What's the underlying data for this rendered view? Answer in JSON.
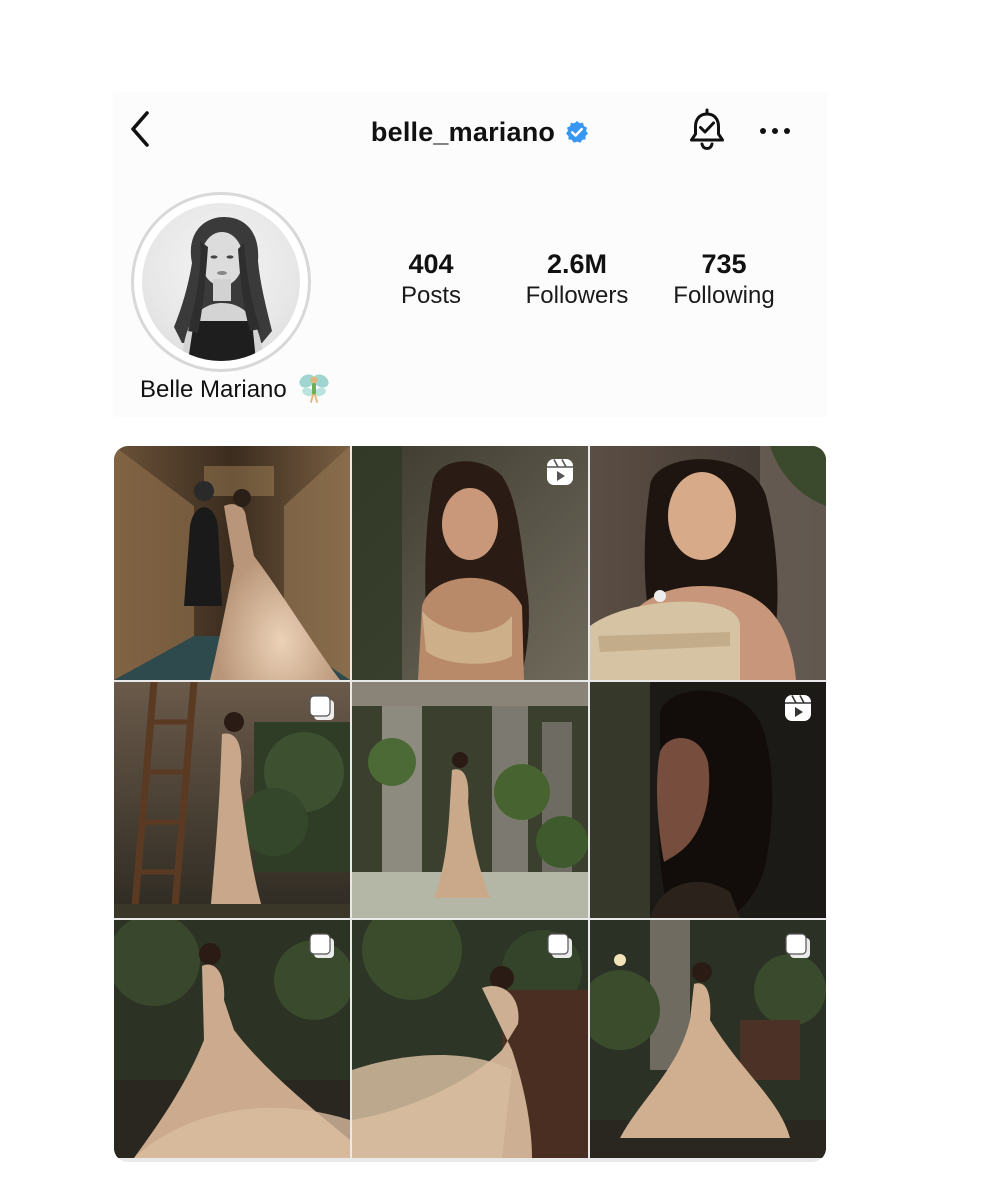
{
  "header": {
    "back_icon": "chevron-left-icon",
    "username": "belle_mariano",
    "verified_icon": "verified-badge-icon",
    "verified_color": "#3897f0",
    "bell_icon": "bell-check-icon",
    "more_icon": "more-horizontal-icon"
  },
  "profile": {
    "display_name": "Belle Mariano",
    "display_name_emoji": "🧚",
    "avatar": "profile-photo-bw"
  },
  "stats": [
    {
      "value": "404",
      "label": "Posts"
    },
    {
      "value": "2.6M",
      "label": "Followers"
    },
    {
      "value": "735",
      "label": "Following"
    }
  ],
  "grid": {
    "tiles": [
      {
        "type": "photo",
        "badge": ""
      },
      {
        "type": "reel",
        "badge": "reel-icon"
      },
      {
        "type": "photo",
        "badge": ""
      },
      {
        "type": "carousel",
        "badge": "carousel-icon"
      },
      {
        "type": "photo",
        "badge": ""
      },
      {
        "type": "reel",
        "badge": "reel-icon"
      },
      {
        "type": "carousel",
        "badge": "carousel-icon"
      },
      {
        "type": "carousel",
        "badge": "carousel-icon"
      },
      {
        "type": "carousel",
        "badge": "carousel-icon"
      }
    ]
  }
}
